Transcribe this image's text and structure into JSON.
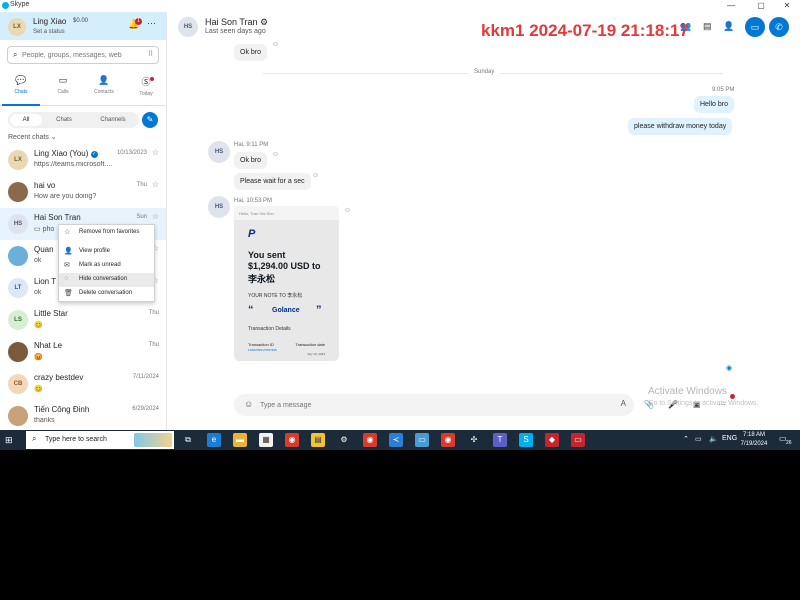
{
  "window": {
    "title": "Skype"
  },
  "profile": {
    "initials": "LX",
    "name": "Ling Xiao",
    "balance": "$0.00",
    "status": "Set a status",
    "notification_count": "1"
  },
  "search": {
    "placeholder": "People, groups, messages, web"
  },
  "nav": {
    "tabs": [
      {
        "label": "Chats"
      },
      {
        "label": "Calls"
      },
      {
        "label": "Contacts"
      },
      {
        "label": "Today"
      }
    ]
  },
  "filters": {
    "all": "All",
    "chats": "Chats",
    "channels": "Channels"
  },
  "recent_label": "Recent chats",
  "chats": [
    {
      "initials": "LX",
      "name": "Ling Xiao (You)",
      "preview": "https://teams.microsoft....",
      "date": "10/13/2023"
    },
    {
      "initials": "",
      "name": "hai vo",
      "preview": "How are you doing?",
      "date": "Thu"
    },
    {
      "initials": "HS",
      "name": "Hai Son Tran",
      "preview": "pho",
      "date": "Sun"
    },
    {
      "initials": "",
      "name": "Quan",
      "preview": "ok",
      "date": ""
    },
    {
      "initials": "LT",
      "name": "Lion T",
      "preview": "ok",
      "date": ""
    },
    {
      "initials": "LS",
      "name": "Little Star",
      "preview": "😊",
      "date": "Thu"
    },
    {
      "initials": "",
      "name": "Nhat Le",
      "preview": "😡",
      "date": "Thu"
    },
    {
      "initials": "CB",
      "name": "crazy bestdev",
      "preview": "😊",
      "date": "7/11/2024"
    },
    {
      "initials": "",
      "name": "Tiến Công Đinh",
      "preview": "thanks",
      "date": "6/29/2024"
    }
  ],
  "context_menu": {
    "items": [
      {
        "label": "Remove from favorites"
      },
      {
        "label": "View profile"
      },
      {
        "label": "Mark as unread"
      },
      {
        "label": "Hide conversation"
      },
      {
        "label": "Delete conversation"
      }
    ]
  },
  "conversation": {
    "initials": "HS",
    "name": "Hai Son Tran",
    "last_seen": "Last seen days ago",
    "watermark": "kkm1 2024-07-19 21:18:17",
    "messages": {
      "m0": "Ok bro",
      "day_separator": "Sunday",
      "out_time": "9:05 PM",
      "out1": "Hello bro",
      "out2": "please withdraw money today",
      "in_meta1": "Hai, 9:11 PM",
      "in1": "Ok bro",
      "in2": "Please wait for a sec",
      "in_meta2": "Hai, 10:53 PM"
    },
    "paypal": {
      "header": "Hello, Tran Hai Son",
      "logo": "P",
      "line1": "You sent",
      "line2": "$1,294.00 USD to",
      "line3": "李永松",
      "note": "YOUR NOTE TO 李永松",
      "note_text": "Golance",
      "details": "Transaction Details",
      "tid_label": "Transaction ID",
      "tid_value": "1SM97081VC567408",
      "date_label": "Transaction date",
      "date_value": "July 19, 2024"
    },
    "input_placeholder": "Type a message"
  },
  "activate": {
    "line1": "Activate Windows",
    "line2": "Go to Settings to activate Windows."
  },
  "taskbar": {
    "search_text": "Type here to search",
    "time": "7:18 AM",
    "date": "7/19/2024",
    "lang": "ENG",
    "notif_count": "26"
  },
  "colors": {
    "accent": "#0078d4",
    "watermark": "#e23a3a",
    "selected_row": "#e6f3fc",
    "taskbar": "#1c2b3a"
  }
}
